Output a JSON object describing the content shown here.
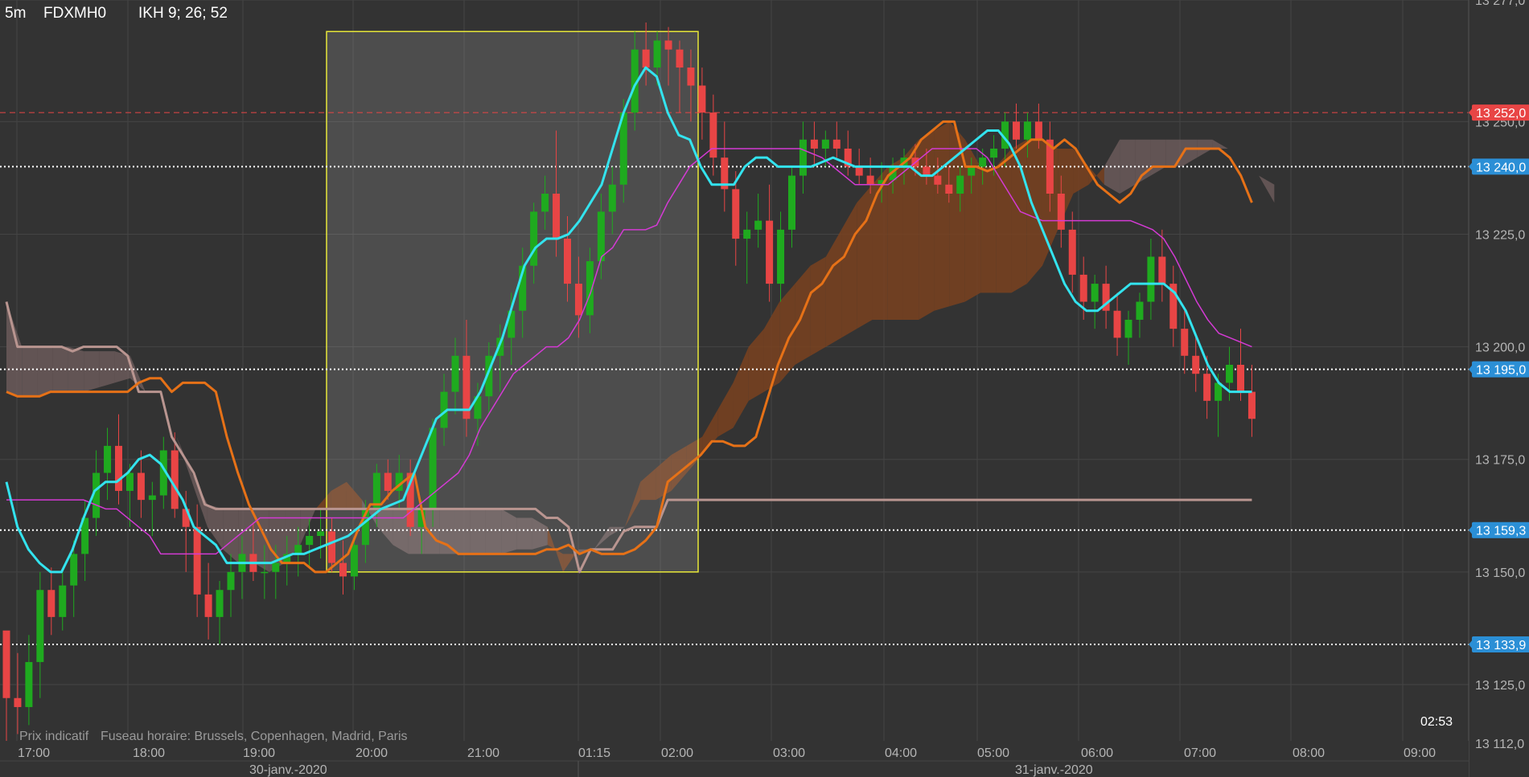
{
  "header": {
    "timeframe": "5m",
    "symbol": "FDXMH0",
    "indicator": "IKH 9; 26; 52"
  },
  "footer": {
    "disclaimer": "Prix indicatif",
    "timezone": "Fuseau horaire: Brussels, Copenhagen, Madrid, Paris",
    "clock": "02:53"
  },
  "colors": {
    "background": "#333333",
    "grid": "#444444",
    "up_candle": "#1faa1f",
    "down_candle": "#e84545",
    "tenkan": "#33e3ee",
    "kijun": "#d43ad4",
    "senkou_a": "#e67117",
    "senkou_b": "#b99590",
    "cloud_bull": "#7a4220",
    "cloud_bear": "#6e5c5c",
    "selection": "#e8e83a",
    "price_label_blue": "#2b8fd6",
    "price_label_red": "#e84545"
  },
  "chart_data": {
    "type": "candlestick",
    "ylim": [
      13112.5,
      13277.0
    ],
    "y_ticks": [
      "13 277,0",
      "13 250,0",
      "13 225,0",
      "13 200,0",
      "13 175,0",
      "13 150,0",
      "13 125,0",
      "13 112,0"
    ],
    "x_ticks": [
      "17:00",
      "18:00",
      "19:00",
      "20:00",
      "21:00",
      "01:15",
      "02:00",
      "03:00",
      "04:00",
      "05:00",
      "06:00",
      "07:00",
      "08:00",
      "09:00"
    ],
    "dates": [
      "30-janv.-2020",
      "31-janv.-2020"
    ],
    "price_lines": [
      {
        "label": "13 252,0",
        "value": 13252.0,
        "style": "dashed",
        "color": "red"
      },
      {
        "label": "13 240,0",
        "value": 13240.0,
        "style": "dotted",
        "color": "blue"
      },
      {
        "label": "13 195,0",
        "value": 13195.0,
        "style": "dotted",
        "color": "blue"
      },
      {
        "label": "13 159,3",
        "value": 13159.3,
        "style": "dotted",
        "color": "blue"
      },
      {
        "label": "13 133,9",
        "value": 13133.9,
        "style": "dotted",
        "color": "blue"
      }
    ],
    "selection": {
      "y_low": 13150,
      "y_high": 13270
    },
    "candles": [
      [
        13137,
        13134,
        13108,
        13122
      ],
      [
        13122,
        13132,
        13114,
        13120
      ],
      [
        13120,
        13136,
        13116,
        13130
      ],
      [
        13130,
        13150,
        13122,
        13146
      ],
      [
        13146,
        13151,
        13136,
        13140
      ],
      [
        13140,
        13150,
        13137,
        13147
      ],
      [
        13147,
        13157,
        13140,
        13154
      ],
      [
        13154,
        13166,
        13148,
        13162
      ],
      [
        13162,
        13177,
        13158,
        13172
      ],
      [
        13172,
        13182,
        13166,
        13178
      ],
      [
        13178,
        13185,
        13165,
        13168
      ],
      [
        13168,
        13174,
        13160,
        13172
      ],
      [
        13172,
        13177,
        13162,
        13166
      ],
      [
        13166,
        13170,
        13158,
        13167
      ],
      [
        13167,
        13180,
        13164,
        13177
      ],
      [
        13177,
        13181,
        13162,
        13164
      ],
      [
        13164,
        13168,
        13150,
        13160
      ],
      [
        13160,
        13165,
        13140,
        13145
      ],
      [
        13145,
        13152,
        13135,
        13140
      ],
      [
        13140,
        13148,
        13134,
        13146
      ],
      [
        13146,
        13154,
        13140,
        13150
      ],
      [
        13150,
        13158,
        13144,
        13154
      ],
      [
        13154,
        13161,
        13148,
        13150
      ],
      [
        13150,
        13156,
        13144,
        13150
      ],
      [
        13150,
        13156,
        13144,
        13152
      ],
      [
        13152,
        13158,
        13147,
        13154
      ],
      [
        13154,
        13160,
        13149,
        13156
      ],
      [
        13156,
        13162,
        13151,
        13158
      ],
      [
        13158,
        13164,
        13153,
        13159
      ],
      [
        13159,
        13162,
        13150,
        13152
      ],
      [
        13152,
        13157,
        13145,
        13149
      ],
      [
        13149,
        13158,
        13146,
        13156
      ],
      [
        13156,
        13166,
        13152,
        13164
      ],
      [
        13164,
        13174,
        13160,
        13172
      ],
      [
        13172,
        13175,
        13166,
        13168
      ],
      [
        13168,
        13176,
        13164,
        13172
      ],
      [
        13172,
        13175,
        13158,
        13160
      ],
      [
        13160,
        13166,
        13154,
        13164
      ],
      [
        13164,
        13184,
        13160,
        13182
      ],
      [
        13182,
        13194,
        13178,
        13190
      ],
      [
        13190,
        13202,
        13185,
        13198
      ],
      [
        13198,
        13206,
        13180,
        13184
      ],
      [
        13184,
        13192,
        13178,
        13189
      ],
      [
        13189,
        13201,
        13185,
        13198
      ],
      [
        13198,
        13205,
        13190,
        13202
      ],
      [
        13202,
        13212,
        13196,
        13208
      ],
      [
        13208,
        13222,
        13202,
        13218
      ],
      [
        13218,
        13232,
        13214,
        13230
      ],
      [
        13230,
        13238,
        13226,
        13234
      ],
      [
        13234,
        13248,
        13220,
        13224
      ],
      [
        13224,
        13229,
        13210,
        13214
      ],
      [
        13214,
        13220,
        13202,
        13207
      ],
      [
        13207,
        13222,
        13203,
        13219
      ],
      [
        13219,
        13234,
        13215,
        13230
      ],
      [
        13230,
        13240,
        13225,
        13236
      ],
      [
        13236,
        13255,
        13232,
        13252
      ],
      [
        13252,
        13270,
        13248,
        13266
      ],
      [
        13266,
        13272,
        13258,
        13262
      ],
      [
        13262,
        13270,
        13258,
        13268
      ],
      [
        13268,
        13271,
        13258,
        13266
      ],
      [
        13266,
        13268,
        13252,
        13262
      ],
      [
        13262,
        13266,
        13250,
        13258
      ],
      [
        13258,
        13262,
        13246,
        13252
      ],
      [
        13252,
        13256,
        13238,
        13242
      ],
      [
        13242,
        13250,
        13230,
        13235
      ],
      [
        13235,
        13239,
        13218,
        13224
      ],
      [
        13224,
        13230,
        13214,
        13226
      ],
      [
        13226,
        13234,
        13222,
        13228
      ],
      [
        13228,
        13236,
        13210,
        13214
      ],
      [
        13214,
        13230,
        13210,
        13226
      ],
      [
        13226,
        13240,
        13222,
        13238
      ],
      [
        13238,
        13250,
        13234,
        13246
      ],
      [
        13246,
        13250,
        13240,
        13244
      ],
      [
        13244,
        13248,
        13240,
        13246
      ],
      [
        13246,
        13250,
        13242,
        13244
      ],
      [
        13244,
        13248,
        13238,
        13240
      ],
      [
        13240,
        13244,
        13236,
        13238
      ],
      [
        13238,
        13242,
        13234,
        13236
      ],
      [
        13236,
        13241,
        13232,
        13237
      ],
      [
        13237,
        13242,
        13234,
        13240
      ],
      [
        13240,
        13244,
        13236,
        13242
      ],
      [
        13242,
        13245,
        13238,
        13240
      ],
      [
        13240,
        13244,
        13236,
        13238
      ],
      [
        13238,
        13242,
        13234,
        13236
      ],
      [
        13236,
        13240,
        13232,
        13234
      ],
      [
        13234,
        13240,
        13230,
        13238
      ],
      [
        13238,
        13242,
        13234,
        13240
      ],
      [
        13240,
        13244,
        13236,
        13242
      ],
      [
        13242,
        13247,
        13238,
        13244
      ],
      [
        13244,
        13252,
        13240,
        13250
      ],
      [
        13250,
        13254,
        13244,
        13246
      ],
      [
        13246,
        13252,
        13242,
        13250
      ],
      [
        13250,
        13254,
        13244,
        13246
      ],
      [
        13246,
        13250,
        13230,
        13234
      ],
      [
        13234,
        13238,
        13222,
        13226
      ],
      [
        13226,
        13230,
        13212,
        13216
      ],
      [
        13216,
        13220,
        13206,
        13210
      ],
      [
        13210,
        13216,
        13204,
        13214
      ],
      [
        13214,
        13218,
        13204,
        13208
      ],
      [
        13208,
        13212,
        13198,
        13202
      ],
      [
        13202,
        13208,
        13196,
        13206
      ],
      [
        13206,
        13212,
        13202,
        13210
      ],
      [
        13210,
        13224,
        13206,
        13220
      ],
      [
        13220,
        13226,
        13210,
        13214
      ],
      [
        13214,
        13218,
        13200,
        13204
      ],
      [
        13204,
        13208,
        13194,
        13198
      ],
      [
        13198,
        13203,
        13190,
        13194
      ],
      [
        13194,
        13198,
        13184,
        13188
      ],
      [
        13188,
        13194,
        13180,
        13192
      ],
      [
        13192,
        13200,
        13188,
        13196
      ],
      [
        13196,
        13204,
        13188,
        13190
      ],
      [
        13190,
        13196,
        13180,
        13184
      ]
    ],
    "tenkan": [
      13170,
      13160,
      13155,
      13152,
      13150,
      13150,
      13155,
      13162,
      13168,
      13170,
      13170,
      13172,
      13175,
      13176,
      13174,
      13170,
      13166,
      13160,
      13158,
      13156,
      13152,
      13152,
      13152,
      13152,
      13152,
      13153,
      13154,
      13154,
      13155,
      13156,
      13157,
      13158,
      13160,
      13162,
      13164,
      13165,
      13166,
      13172,
      13178,
      13184,
      13186,
      13186,
      13186,
      13190,
      13196,
      13202,
      13210,
      13218,
      13222,
      13224,
      13224,
      13225,
      13228,
      13232,
      13236,
      13244,
      13252,
      13258,
      13262,
      13260,
      13252,
      13247,
      13246,
      13240,
      13236,
      13236,
      13236,
      13240,
      13242,
      13242,
      13240,
      13240,
      13240,
      13240,
      13241,
      13242,
      13241,
      13240,
      13240,
      13240,
      13240,
      13240,
      13240,
      13238,
      13238,
      13240,
      13242,
      13244,
      13246,
      13248,
      13248,
      13245,
      13240,
      13232,
      13226,
      13220,
      13214,
      13210,
      13208,
      13208,
      13210,
      13212,
      13214,
      13214,
      13214,
      13214,
      13212,
      13208,
      13202,
      13196,
      13192,
      13190,
      13190,
      13190
    ],
    "kijun": [
      13166,
      13166,
      13166,
      13166,
      13166,
      13166,
      13166,
      13166,
      13165,
      13164,
      13164,
      13162,
      13160,
      13158,
      13154,
      13154,
      13154,
      13154,
      13154,
      13154,
      13156,
      13158,
      13160,
      13162,
      13162,
      13162,
      13162,
      13162,
      13162,
      13162,
      13162,
      13162,
      13162,
      13162,
      13162,
      13162,
      13162,
      13164,
      13166,
      13168,
      13170,
      13172,
      13176,
      13182,
      13186,
      13190,
      13194,
      13196,
      13198,
      13200,
      13200,
      13202,
      13206,
      13212,
      13220,
      13222,
      13226,
      13226,
      13226,
      13227,
      13232,
      13236,
      13240,
      13242,
      13244,
      13244,
      13244,
      13244,
      13244,
      13244,
      13244,
      13244,
      13244,
      13243,
      13242,
      13240,
      13238,
      13236,
      13236,
      13236,
      13236,
      13238,
      13240,
      13242,
      13244,
      13244,
      13244,
      13244,
      13244,
      13242,
      13238,
      13234,
      13230,
      13229,
      13228,
      13228,
      13228,
      13228,
      13228,
      13228,
      13228,
      13228,
      13228,
      13227,
      13226,
      13224,
      13220,
      13215,
      13210,
      13206,
      13203,
      13202,
      13201,
      13200
    ],
    "senkou_a": [
      13190,
      13189,
      13189,
      13189,
      13190,
      13190,
      13190,
      13190,
      13190,
      13190,
      13190,
      13190,
      13192,
      13193,
      13193,
      13190,
      13192,
      13192,
      13192,
      13190,
      13180,
      13172,
      13165,
      13160,
      13155,
      13152,
      13152,
      13152,
      13150,
      13150,
      13152,
      13154,
      13160,
      13165,
      13165,
      13168,
      13170,
      13172,
      13160,
      13157,
      13156,
      13154,
      13154,
      13154,
      13154,
      13154,
      13154,
      13154,
      13154,
      13155,
      13155,
      13156,
      13154,
      13155,
      13154,
      13154,
      13154,
      13155,
      13157,
      13160,
      13170,
      13172,
      13174,
      13176,
      13179,
      13179,
      13178,
      13178,
      13180,
      13188,
      13196,
      13202,
      13206,
      13212,
      13214,
      13218,
      13220,
      13225,
      13228,
      13234,
      13238,
      13240,
      13242,
      13246,
      13248,
      13250,
      13250,
      13240,
      13240,
      13239,
      13240,
      13242,
      13244,
      13246,
      13246,
      13244,
      13246,
      13244,
      13240,
      13236,
      13234,
      13232,
      13234,
      13238,
      13240,
      13240,
      13240,
      13244,
      13244,
      13244,
      13244,
      13242,
      13238,
      13232
    ],
    "senkou_b": [
      13210,
      13200,
      13200,
      13200,
      13200,
      13200,
      13199,
      13200,
      13200,
      13200,
      13200,
      13198,
      13190,
      13190,
      13190,
      13180,
      13176,
      13172,
      13165,
      13164,
      13164,
      13164,
      13164,
      13164,
      13164,
      13164,
      13164,
      13164,
      13164,
      13164,
      13164,
      13164,
      13164,
      13164,
      13164,
      13164,
      13164,
      13164,
      13164,
      13164,
      13164,
      13164,
      13164,
      13164,
      13164,
      13164,
      13164,
      13164,
      13164,
      13162,
      13162,
      13160,
      13150,
      13155,
      13155,
      13155,
      13159,
      13160,
      13160,
      13160,
      13166,
      13166,
      13166,
      13166,
      13166,
      13166,
      13166,
      13166,
      13166,
      13166,
      13166,
      13166,
      13166,
      13166,
      13166,
      13166,
      13166,
      13166,
      13166,
      13166,
      13166,
      13166,
      13166,
      13166,
      13166,
      13166,
      13166,
      13166,
      13166,
      13166,
      13166,
      13166,
      13166,
      13166,
      13166,
      13166,
      13166,
      13166,
      13166,
      13166,
      13166,
      13166,
      13166,
      13166,
      13166,
      13166,
      13166,
      13166,
      13166,
      13166,
      13166,
      13166,
      13166,
      13166
    ],
    "cloud_segments": [
      {
        "a": [
          13190,
          13189,
          13189,
          13190,
          13190,
          13190,
          13191,
          13192,
          13193,
          13190,
          13190,
          13180,
          13170,
          13160,
          13155,
          13152,
          13152,
          13150,
          13152,
          13156,
          13164,
          13168,
          13170,
          13166,
          13160,
          13156,
          13154,
          13154,
          13154,
          13154,
          13154,
          13154,
          13154,
          13155,
          13155,
          13156,
          13154,
          13154,
          13155,
          13158,
          13160,
          13170,
          13173,
          13176,
          13178,
          13180,
          13186,
          13192,
          13200,
          13204,
          13210,
          13214,
          13218,
          13220,
          13226,
          13232,
          13236,
          13240,
          13242,
          13246,
          13248,
          13250,
          13246,
          13240,
          13240,
          13244,
          13246,
          13246,
          13244,
          13244,
          13240,
          13236,
          13234,
          13236,
          13238,
          13240,
          13240,
          13242,
          13244,
          13244,
          13242,
          13238,
          13232
        ],
        "b": [
          13210,
          13200,
          13200,
          13200,
          13200,
          13199,
          13199,
          13199,
          13198,
          13190,
          13190,
          13180,
          13172,
          13165,
          13164,
          13164,
          13164,
          13164,
          13164,
          13164,
          13164,
          13164,
          13164,
          13164,
          13164,
          13164,
          13164,
          13164,
          13164,
          13164,
          13164,
          13164,
          13164,
          13162,
          13162,
          13160,
          13150,
          13155,
          13155,
          13160,
          13160,
          13166,
          13166,
          13168,
          13172,
          13176,
          13180,
          13182,
          13188,
          13190,
          13192,
          13196,
          13198,
          13200,
          13202,
          13204,
          13206,
          13206,
          13206,
          13206,
          13208,
          13209,
          13210,
          13212,
          13212,
          13212,
          13214,
          13218,
          13226,
          13234,
          13236,
          13240,
          13246,
          13246,
          13246,
          13246,
          13246,
          13246,
          13246,
          13244,
          13242,
          13238,
          13236
        ]
      }
    ]
  }
}
